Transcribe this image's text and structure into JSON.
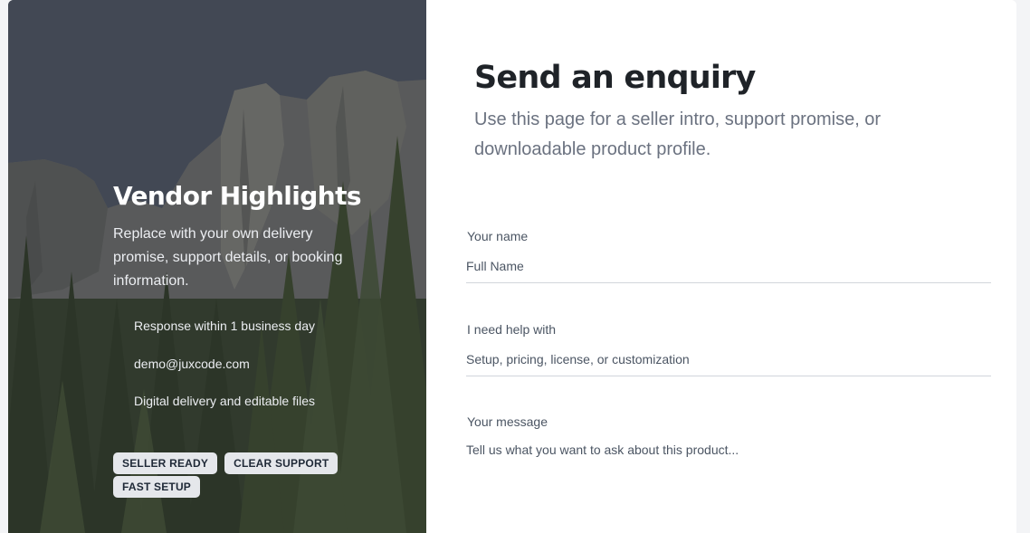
{
  "vendor": {
    "title": "Vendor Highlights",
    "description": "Replace with your own delivery promise, support details, or booking information.",
    "features": [
      "Response within 1 business day",
      "demo@juxcode.com",
      "Digital delivery and editable files"
    ],
    "badges": [
      "SELLER READY",
      "CLEAR SUPPORT",
      "FAST SETUP"
    ]
  },
  "enquiry": {
    "title": "Send an enquiry",
    "subtitle": "Use this page for a seller intro, support promise, or downloadable product profile.",
    "fields": [
      {
        "label": "Your name",
        "placeholder": "Full Name"
      },
      {
        "label": "I need help with",
        "placeholder": "Setup, pricing, license, or customization"
      },
      {
        "label": "Your message",
        "placeholder": "Tell us what you want to ask about this product..."
      }
    ]
  },
  "colors": {
    "badge_bg": "#e5e7eb",
    "title_text": "#1f2328",
    "muted_text": "#6b7280",
    "divider": "#d1d5db"
  }
}
